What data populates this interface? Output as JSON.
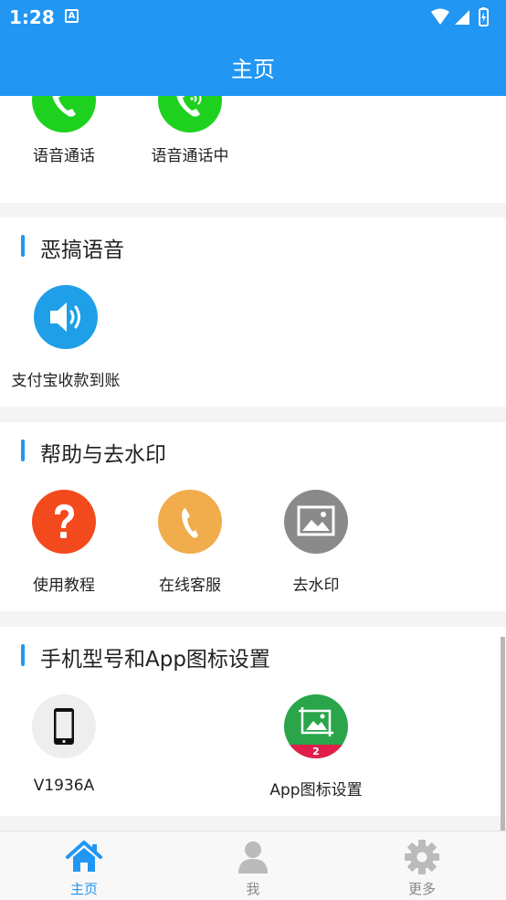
{
  "status_bar": {
    "time": "1:28",
    "notification_icon": "A"
  },
  "app_bar": {
    "title": "主页"
  },
  "sections": [
    {
      "id": "voice-call",
      "title": "",
      "items": [
        {
          "label": "语音通话",
          "icon": "phone-icon",
          "color": "#1fd11f"
        },
        {
          "label": "语音通话中",
          "icon": "phone-ringing-icon",
          "color": "#1fd11f"
        }
      ]
    },
    {
      "id": "prank-voice",
      "title": "恶搞语音",
      "items": [
        {
          "label": "支付宝收款到账",
          "icon": "speaker-icon",
          "color": "#1e9fe8"
        }
      ]
    },
    {
      "id": "help-watermark",
      "title": "帮助与去水印",
      "items": [
        {
          "label": "使用教程",
          "icon": "question-icon",
          "color": "#f24a1d"
        },
        {
          "label": "在线客服",
          "icon": "phone-icon",
          "color": "#f1ac4b"
        },
        {
          "label": "去水印",
          "icon": "image-icon",
          "color": "#8a8a8a"
        }
      ]
    },
    {
      "id": "phone-model",
      "title": "手机型号和App图标设置",
      "items": [
        {
          "label": "V1936A",
          "icon": "smartphone-icon",
          "color": "#eeeeee"
        },
        {
          "label": "App图标设置",
          "icon": "app-icon-settings-icon",
          "color": "#2aa54a",
          "badge": "2",
          "badge_color": "#e01e4c"
        }
      ]
    }
  ],
  "bottom_nav": {
    "items": [
      {
        "label": "主页",
        "icon": "home-icon",
        "active": true
      },
      {
        "label": "我",
        "icon": "person-icon",
        "active": false
      },
      {
        "label": "更多",
        "icon": "gear-icon",
        "active": false
      }
    ],
    "active_color": "#2196f3",
    "inactive_color": "#bbbbbb"
  }
}
